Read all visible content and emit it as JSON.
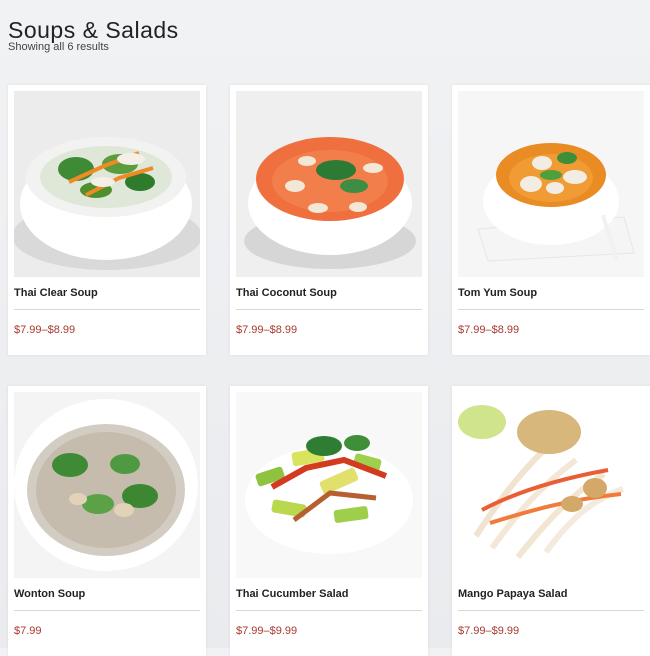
{
  "header": {
    "title": "Soups & Salads",
    "results_text": "Showing all 6 results"
  },
  "products": [
    {
      "name": "Thai Clear Soup",
      "price": "$7.99–$8.99",
      "image": "thai-clear-soup-photo"
    },
    {
      "name": "Thai Coconut Soup",
      "price": "$7.99–$8.99",
      "image": "thai-coconut-soup-photo"
    },
    {
      "name": "Tom Yum Soup",
      "price": "$7.99–$8.99",
      "image": "tom-yum-soup-photo"
    },
    {
      "name": "Wonton Soup",
      "price": "$7.99",
      "image": "wonton-soup-photo"
    },
    {
      "name": "Thai Cucumber Salad",
      "price": "$7.99–$9.99",
      "image": "thai-cucumber-salad-photo"
    },
    {
      "name": "Mango Papaya Salad",
      "price": "$7.99–$9.99",
      "image": "mango-papaya-salad-photo"
    }
  ],
  "colors": {
    "price": "#a63a2f",
    "background": "#eceef1",
    "card": "#ffffff"
  }
}
